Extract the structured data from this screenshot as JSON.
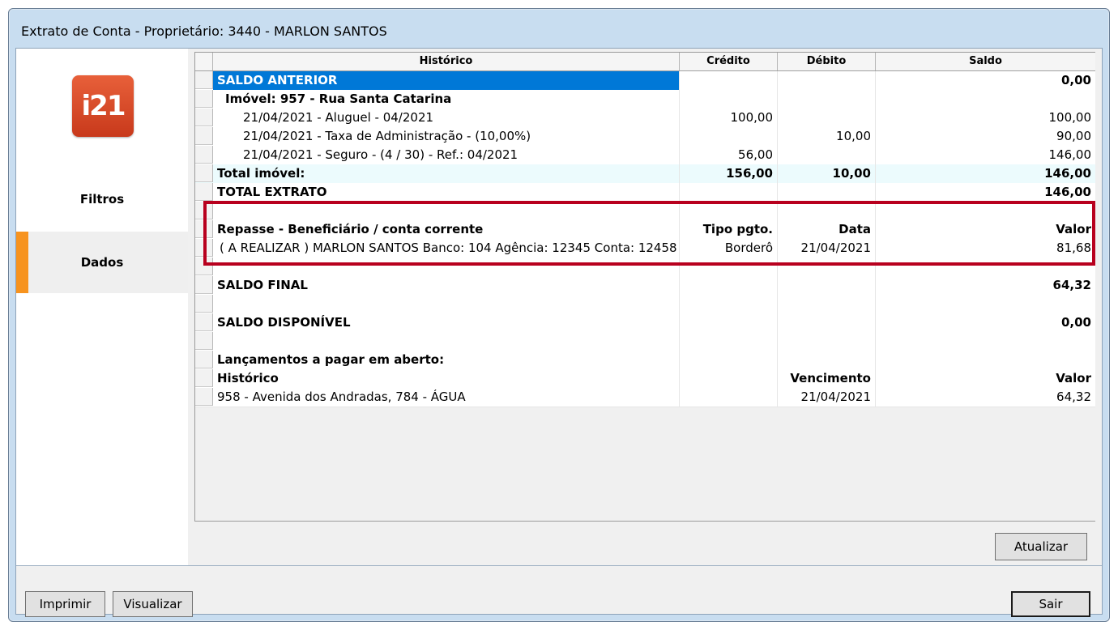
{
  "window": {
    "title": "Extrato de Conta - Proprietário: 3440 - MARLON SANTOS"
  },
  "logo": {
    "text": "i21"
  },
  "nav": {
    "filtros": "Filtros",
    "dados": "Dados"
  },
  "grid": {
    "headers": [
      "Histórico",
      "Crédito",
      "Débito",
      "Saldo"
    ],
    "rows": [
      [
        "SALDO ANTERIOR",
        "",
        "",
        "0,00"
      ],
      [
        "Imóvel: 957 - Rua Santa Catarina",
        "",
        "",
        ""
      ],
      [
        "21/04/2021 - Aluguel - 04/2021",
        "100,00",
        "",
        "100,00"
      ],
      [
        "21/04/2021 - Taxa de Administração - (10,00%)",
        "",
        "10,00",
        "90,00"
      ],
      [
        "21/04/2021 - Seguro - (4 / 30) - Ref.: 04/2021",
        "56,00",
        "",
        "146,00"
      ],
      [
        "Total imóvel:",
        "156,00",
        "10,00",
        "146,00"
      ],
      [
        "TOTAL EXTRATO",
        "",
        "",
        "146,00"
      ],
      [
        "",
        "",
        "",
        ""
      ],
      [
        "Repasse - Beneficiário / conta corrente",
        "Tipo pgto.",
        "Data",
        "Valor"
      ],
      [
        "( A REALIZAR ) MARLON SANTOS Banco: 104 Agência: 12345 Conta: 12458",
        "Borderô",
        "21/04/2021",
        "81,68"
      ],
      [
        "",
        "",
        "",
        ""
      ],
      [
        "SALDO FINAL",
        "",
        "",
        "64,32"
      ],
      [
        "",
        "",
        "",
        ""
      ],
      [
        "SALDO DISPONÍVEL",
        "",
        "",
        "0,00"
      ],
      [
        "",
        "",
        "",
        ""
      ],
      [
        "Lançamentos a pagar em aberto:",
        "",
        "",
        ""
      ],
      [
        "Histórico",
        "",
        "Vencimento",
        "Valor"
      ],
      [
        "958 - Avenida dos Andradas, 784 - ÁGUA",
        "",
        "21/04/2021",
        "64,32"
      ]
    ]
  },
  "buttons": {
    "atualizar": "Atualizar",
    "imprimir": "Imprimir",
    "visualizar": "Visualizar",
    "sair": "Sair"
  },
  "colors": {
    "selection": "#0078d7",
    "accent": "#f7931e",
    "highlight": "#b8001e",
    "logo": "#d9482a"
  }
}
